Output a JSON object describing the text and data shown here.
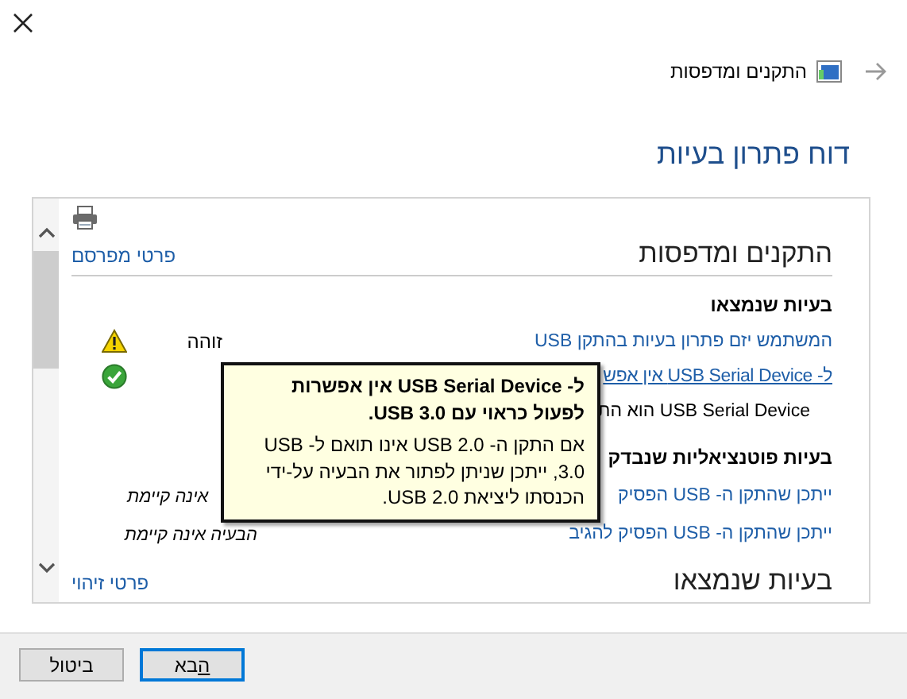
{
  "breadcrumb": {
    "label": "התקנים ומדפסות"
  },
  "title": "דוח פתרון בעיות",
  "report": {
    "sections": [
      {
        "heading": "התקנים ומדפסות",
        "link": "פרטי מפרסם",
        "groups": [
          {
            "heading": "בעיות שנמצאו",
            "rows": [
              {
                "kind": "problem",
                "text": "המשתמש יזם פתרון בעיות בהתקן USB",
                "status": "זוהה",
                "resolved": false,
                "hovered": false
              },
              {
                "kind": "problem",
                "text": "ל- USB Serial Device אין אפש",
                "resolved": true,
                "hovered": true
              },
              {
                "kind": "description",
                "text": "USB Serial Device הוא הת"
              }
            ]
          },
          {
            "heading": "בעיות פוטנציאליות שנבדק",
            "rows": [
              {
                "kind": "check",
                "text": "ייתכן שהתקן ה- USB הפסיק",
                "status": "אינה קיימת",
                "hovered": false
              },
              {
                "kind": "check",
                "text": "ייתכן שהתקן ה- USB הפסיק להגיב",
                "status": "הבעיה אינה קיימת",
                "hovered": false
              }
            ]
          }
        ]
      },
      {
        "heading": "בעיות שנמצאו",
        "link": "פרטי זיהוי"
      }
    ]
  },
  "tooltip": {
    "title": "ל- USB Serial Device אין אפשרות לפעול כראוי עם USB 3.0.",
    "body": "אם התקן ה- USB 2.0 אינו תואם ל- USB 3.0, ייתכן שניתן לפתור את הבעיה על-ידי הכנסתו ליציאת USB 2.0."
  },
  "buttons": [
    {
      "label": "הבא",
      "default": true,
      "mnemonic": true
    },
    {
      "label": "ביטול",
      "default": false,
      "mnemonic": false
    }
  ]
}
